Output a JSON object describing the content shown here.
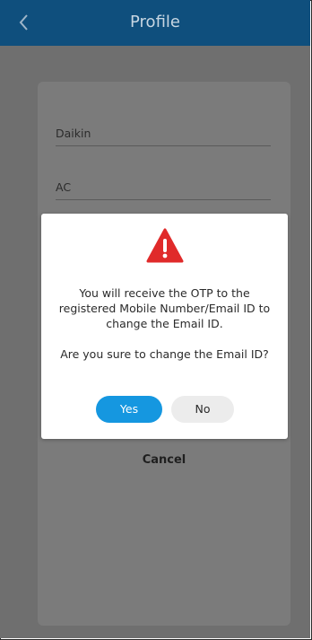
{
  "header": {
    "title": "Profile",
    "back_icon": "chevron-left-icon"
  },
  "form": {
    "fields": [
      {
        "value": "Daikin"
      },
      {
        "value": "AC"
      }
    ],
    "cancel_label": "Cancel"
  },
  "dialog": {
    "icon": "warning-icon",
    "message_line1": "You will receive the OTP to the registered Mobile Number/Email ID to change the Email ID.",
    "message_line2": "Are you sure to change the Email ID?",
    "yes_label": "Yes",
    "no_label": "No",
    "colors": {
      "accent": "#1597e0",
      "warning": "#e02a2a",
      "header": "#0f4f7d"
    }
  }
}
